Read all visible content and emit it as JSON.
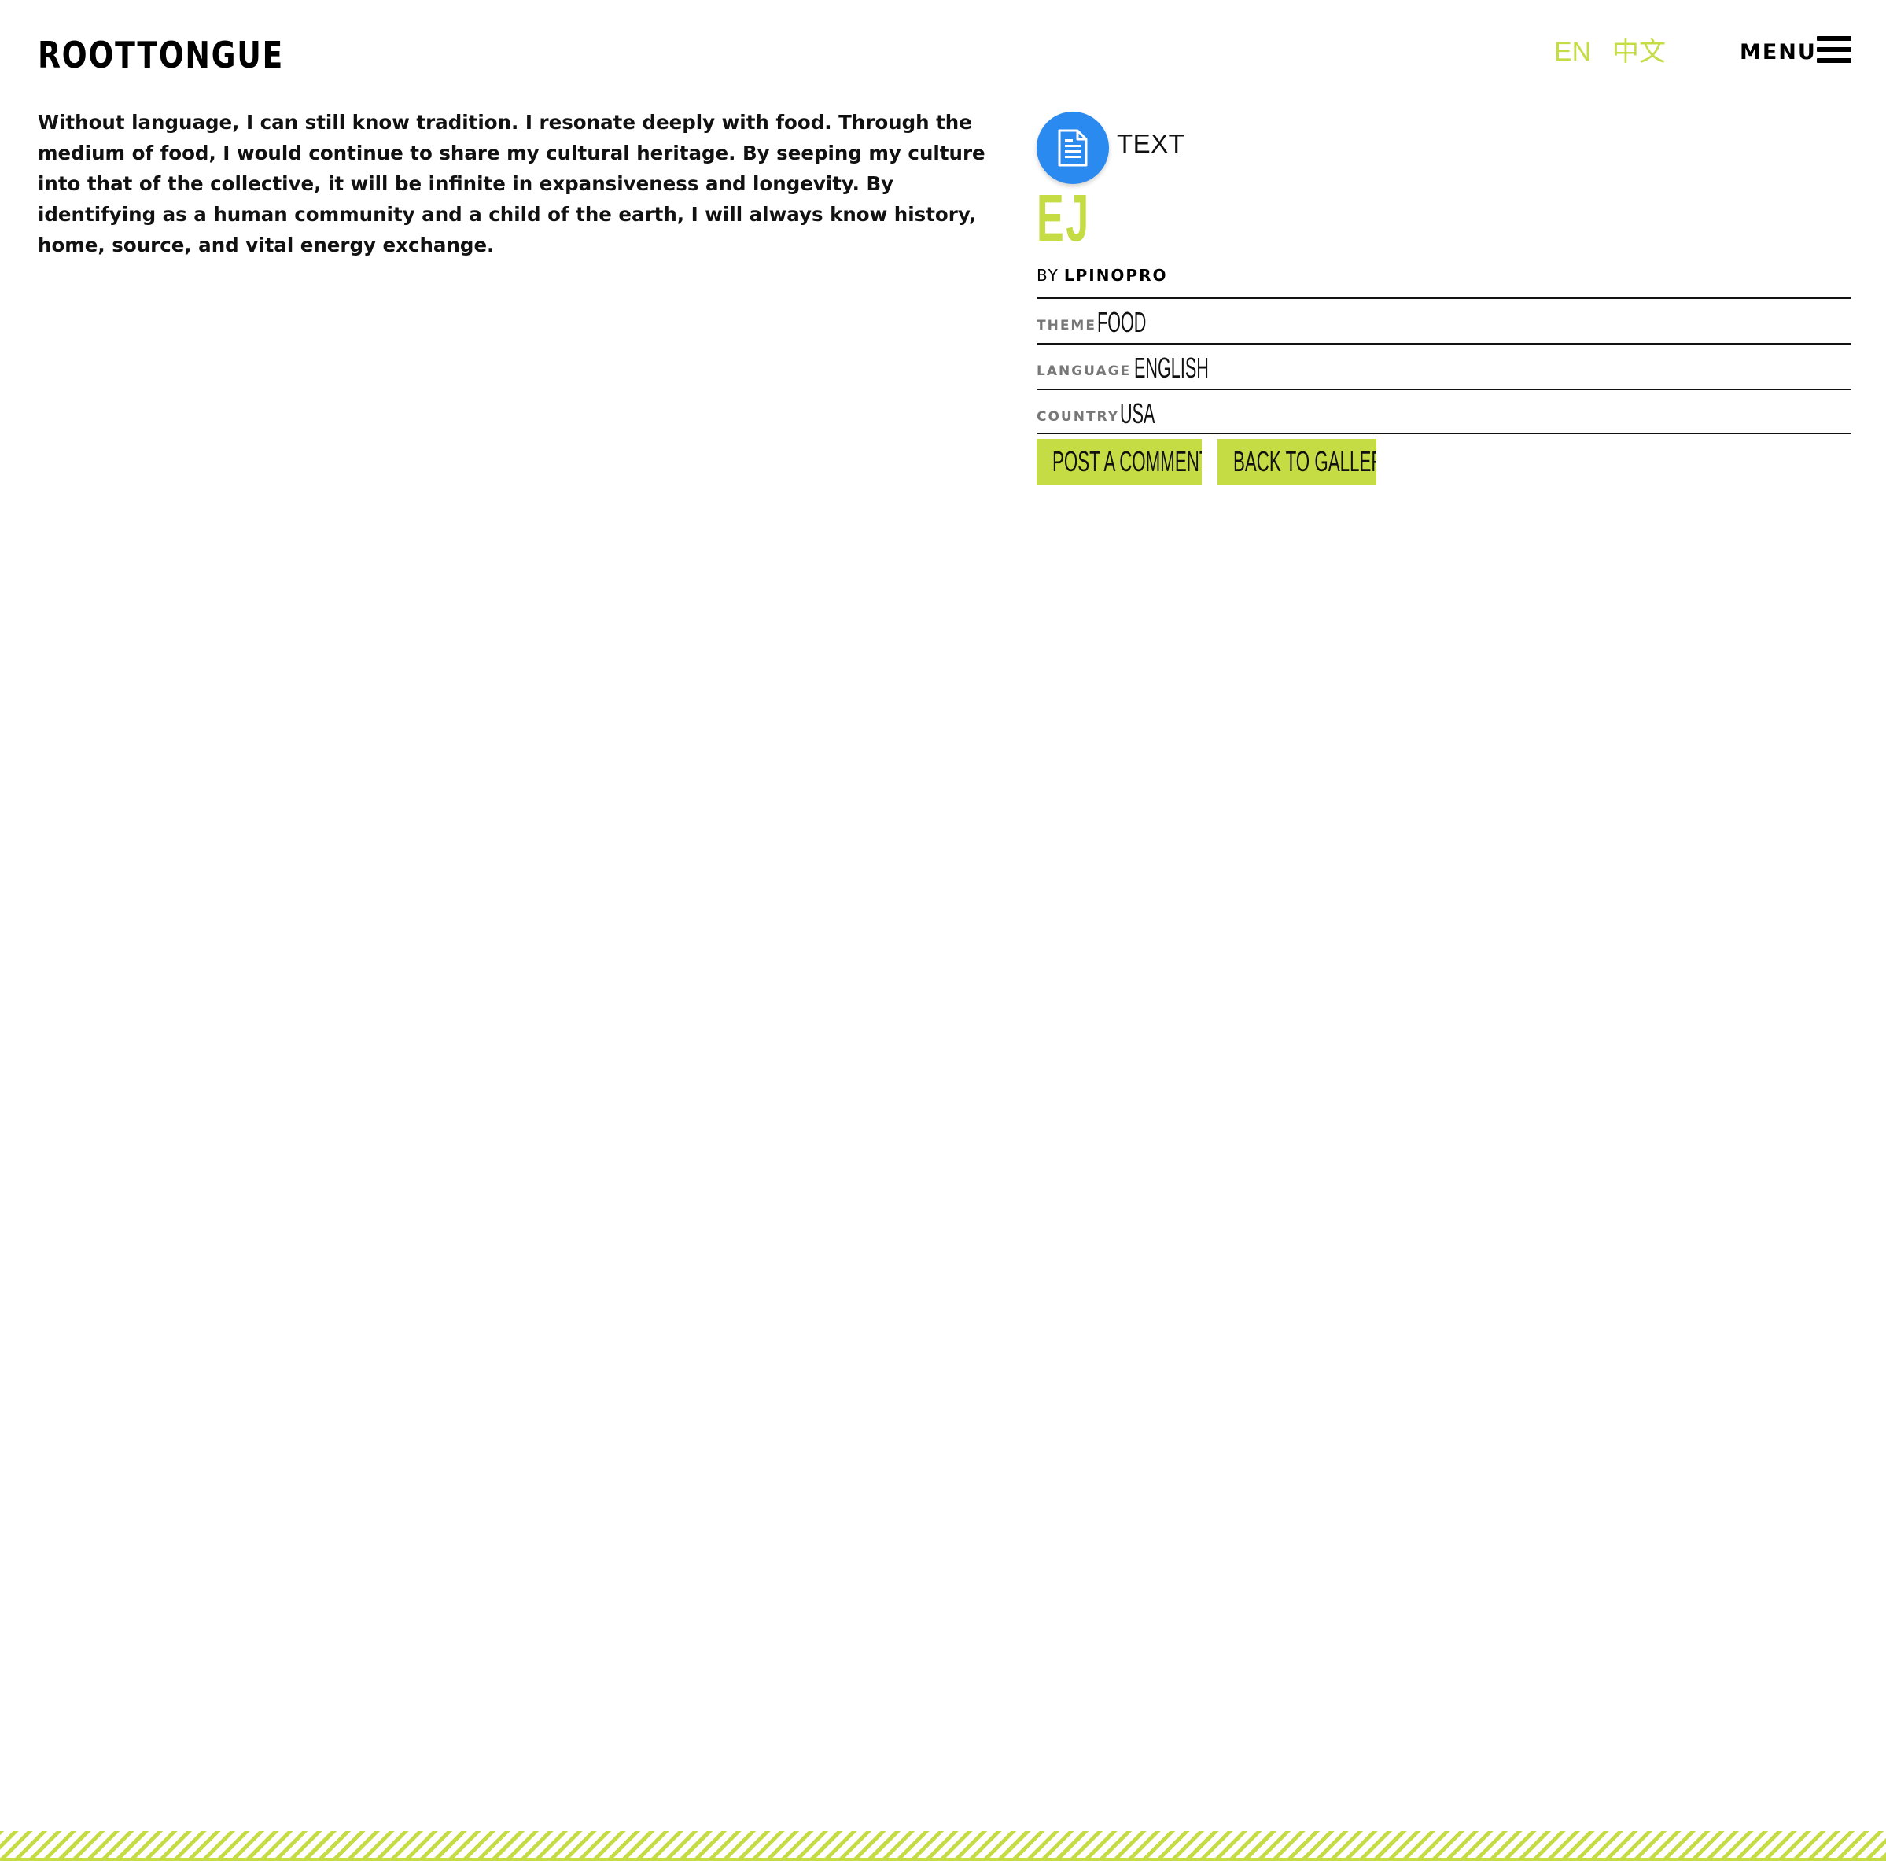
{
  "header": {
    "logo_text": "ROOTTONGUE",
    "languages": [
      "EN",
      "中文"
    ],
    "menu_label": "MENU"
  },
  "entry": {
    "body": "Without language, I can still know tradition. I resonate deeply with food. Through the medium of food, I would continue to share my cultural heritage. By seeping my culture into that of the collective, it will be infinite in expansiveness and longevity. By identifying as a human community and a child of the earth, I will always know history, home, source, and vital energy exchange.",
    "media_type": "TEXT",
    "title": "EJ",
    "by_label": "BY",
    "author": "LPINOPRO",
    "meta": [
      {
        "key": "THEME",
        "value": "FOOD"
      },
      {
        "key": "LANGUAGE",
        "value": "ENGLISH"
      },
      {
        "key": "COUNTRY",
        "value": "USA"
      }
    ],
    "actions": {
      "post_comment": "POST A COMMENT",
      "back_to_gallery": "BACK TO GALLERY"
    }
  },
  "colors": {
    "accent": "#c5dc45",
    "media_badge": "#2b8af0",
    "text": "#111111",
    "muted": "#777777"
  },
  "icons": {
    "media": "document-icon",
    "menu": "hamburger-icon"
  }
}
